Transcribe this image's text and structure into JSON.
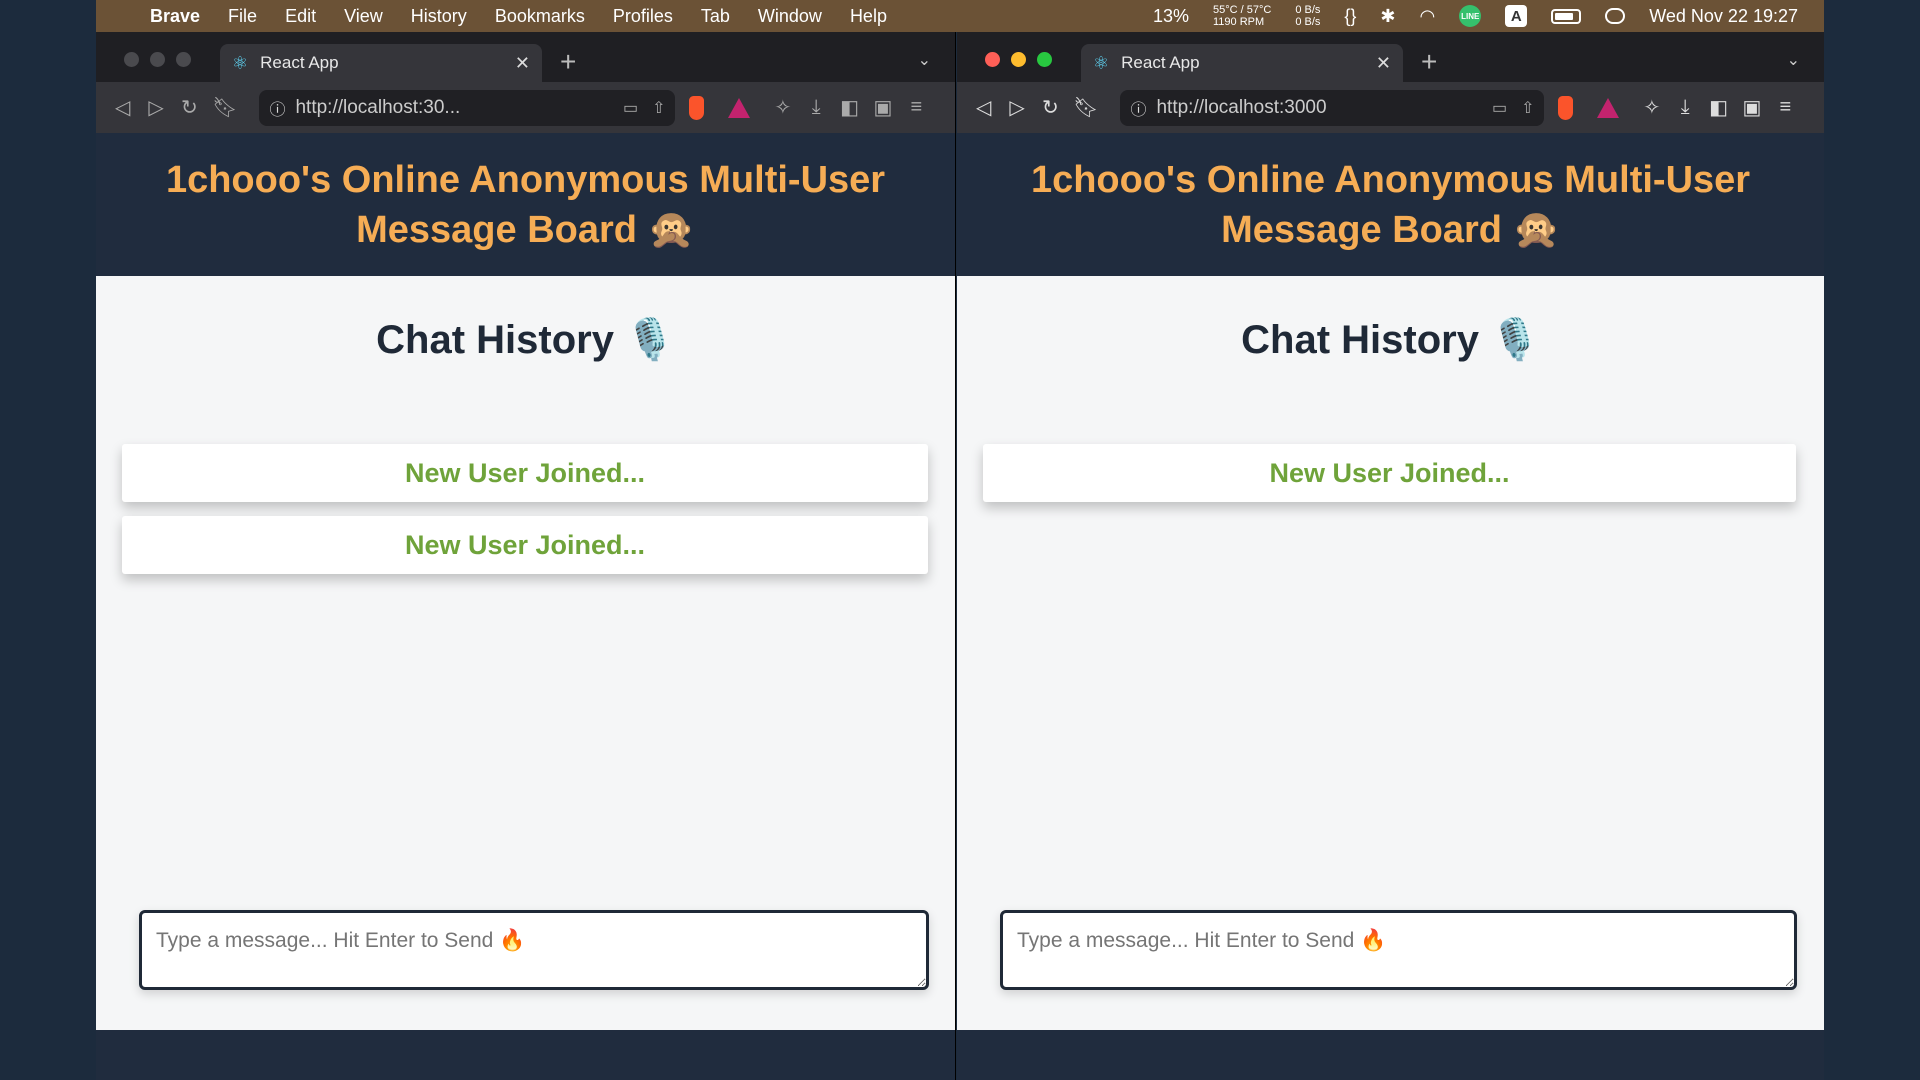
{
  "menubar": {
    "apple": "",
    "app_name": "Brave",
    "menus": [
      "File",
      "Edit",
      "View",
      "History",
      "Bookmarks",
      "Profiles",
      "Tab",
      "Window",
      "Help"
    ],
    "cpu": "13%",
    "temp": "55°C / 57°C",
    "rpm": "1190 RPM",
    "net_up": "0 B/s",
    "net_down": "0 B/s",
    "braces": "{}",
    "line_label": "LINE",
    "input_source": "A",
    "clock": "Wed Nov 22  19:27"
  },
  "windows": [
    {
      "tab_title": "React App",
      "url": "http://localhost:30...",
      "page": {
        "title": "1chooo's Online Anonymous Multi-User Message Board 🙊",
        "history_title": "Chat History 🎙️",
        "messages": [
          "New User Joined...",
          "New User Joined..."
        ],
        "composer_placeholder": "Type a message... Hit Enter to Send 🔥"
      }
    },
    {
      "tab_title": "React App",
      "url": "http://localhost:3000",
      "page": {
        "title": "1chooo's Online Anonymous Multi-User Message Board 🙊",
        "history_title": "Chat History 🎙️",
        "messages": [
          "New User Joined..."
        ],
        "composer_placeholder": "Type a message... Hit Enter to Send 🔥"
      }
    }
  ],
  "colors": {
    "menubar_bg": "#6b5236",
    "header_bg": "#202c3e",
    "title_orange": "#f6ad55",
    "message_green": "#6fa33a",
    "page_bg": "#f5f6f7"
  },
  "icons": {
    "back": "back-arrow-icon",
    "forward": "forward-arrow-icon",
    "reload": "reload-icon",
    "bookmark": "bookmark-icon",
    "react": "react-logo-icon"
  }
}
